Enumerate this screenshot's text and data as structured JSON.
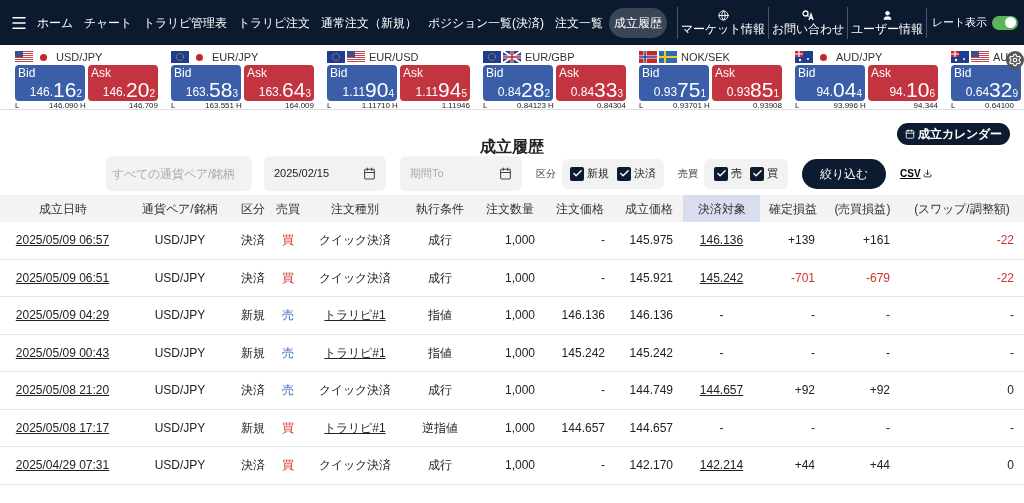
{
  "nav": {
    "items": [
      {
        "label": "ホーム",
        "selected": false
      },
      {
        "label": "チャート",
        "selected": false
      },
      {
        "label": "トラリピ管理表",
        "selected": false
      },
      {
        "label": "トラリピ注文",
        "selected": false
      },
      {
        "label": "通常注文（新規）",
        "selected": false
      },
      {
        "label": "ポジション一覧(決済)",
        "selected": false
      },
      {
        "label": "注文一覧",
        "selected": false
      },
      {
        "label": "成立履歴",
        "selected": true
      }
    ],
    "tools": [
      {
        "kind": "globe",
        "label": "マーケット情報"
      },
      {
        "kind": "qa",
        "label": "お問い合わせ"
      },
      {
        "kind": "user",
        "label": "ユーザー情報"
      }
    ],
    "rate_toggle": {
      "label": "レート表示",
      "on": true
    }
  },
  "rates": [
    {
      "pair": "USD/JPY",
      "flags": [
        {
          "kind": "us"
        },
        {
          "kind": "jp"
        }
      ],
      "bid": {
        "label": "Bid",
        "prefix": "146.",
        "big": "16",
        "pip": "2"
      },
      "ask": {
        "label": "Ask",
        "prefix": "146.",
        "big": "20",
        "pip": "2"
      },
      "low_label": "L",
      "low": "146.090",
      "high_label": "H",
      "high": "146.709"
    },
    {
      "pair": "EUR/JPY",
      "flags": [
        {
          "kind": "eu"
        },
        {
          "kind": "jp"
        }
      ],
      "bid": {
        "label": "Bid",
        "prefix": "163.",
        "big": "58",
        "pip": "3"
      },
      "ask": {
        "label": "Ask",
        "prefix": "163.",
        "big": "64",
        "pip": "3"
      },
      "low_label": "L",
      "low": "163.551",
      "high_label": "H",
      "high": "164.009"
    },
    {
      "pair": "EUR/USD",
      "flags": [
        {
          "kind": "eu"
        },
        {
          "kind": "us"
        }
      ],
      "bid": {
        "label": "Bid",
        "prefix": "1.11",
        "big": "90",
        "pip": "4"
      },
      "ask": {
        "label": "Ask",
        "prefix": "1.11",
        "big": "94",
        "pip": "5"
      },
      "low_label": "L",
      "low": "1.11710",
      "high_label": "H",
      "high": "1.11946"
    },
    {
      "pair": "EUR/GBP",
      "flags": [
        {
          "kind": "eu"
        },
        {
          "kind": "gb"
        }
      ],
      "bid": {
        "label": "Bid",
        "prefix": "0.84",
        "big": "28",
        "pip": "2"
      },
      "ask": {
        "label": "Ask",
        "prefix": "0.84",
        "big": "33",
        "pip": "3"
      },
      "low_label": "L",
      "low": "0.84123",
      "high_label": "H",
      "high": "0.84304"
    },
    {
      "pair": "NOK/SEK",
      "flags": [
        {
          "kind": "no"
        },
        {
          "kind": "se"
        }
      ],
      "bid": {
        "label": "Bid",
        "prefix": "0.93",
        "big": "75",
        "pip": "1"
      },
      "ask": {
        "label": "Ask",
        "prefix": "0.93",
        "big": "85",
        "pip": "1"
      },
      "low_label": "L",
      "low": "0.93701",
      "high_label": "H",
      "high": "0.93908"
    },
    {
      "pair": "AUD/JPY",
      "flags": [
        {
          "kind": "au"
        },
        {
          "kind": "jp"
        }
      ],
      "bid": {
        "label": "Bid",
        "prefix": "94.",
        "big": "04",
        "pip": "4"
      },
      "ask": {
        "label": "Ask",
        "prefix": "94.",
        "big": "10",
        "pip": "6"
      },
      "low_label": "L",
      "low": "93.996",
      "high_label": "H",
      "high": "94.344"
    },
    {
      "pair": "AU",
      "flags": [
        {
          "kind": "au"
        },
        {
          "kind": "us"
        }
      ],
      "bid": {
        "label": "Bid",
        "prefix": "0.64",
        "big": "32",
        "pip": "9"
      },
      "low_label": "L",
      "low": "0.64100"
    }
  ],
  "page": {
    "title": "成立履歴",
    "calendar_button": "成立カレンダー"
  },
  "filters": {
    "pair": {
      "placeholder": "すべての通貨ペア/銘柄"
    },
    "from": {
      "value": "2025/02/15"
    },
    "to": {
      "placeholder": "期間To"
    },
    "category": {
      "label": "区分",
      "options": [
        {
          "label": "新規",
          "checked": true
        },
        {
          "label": "決済",
          "checked": true
        }
      ]
    },
    "side": {
      "label": "売買",
      "options": [
        {
          "label": "売",
          "checked": true
        },
        {
          "label": "買",
          "checked": true
        }
      ]
    },
    "submit": "絞り込む",
    "csv": "CSV"
  },
  "table": {
    "columns": [
      {
        "label": "成立日時",
        "highlight": false
      },
      {
        "label": "通貨ペア/銘柄",
        "highlight": false
      },
      {
        "label": "区分",
        "highlight": false
      },
      {
        "label": "売買",
        "highlight": false
      },
      {
        "label": "注文種別",
        "highlight": false
      },
      {
        "label": "執行条件",
        "highlight": false
      },
      {
        "label": "注文数量",
        "highlight": false
      },
      {
        "label": "注文価格",
        "highlight": false
      },
      {
        "label": "成立価格",
        "highlight": false
      },
      {
        "label": "決済対象",
        "highlight": true
      },
      {
        "label": "確定損益",
        "highlight": false
      },
      {
        "label": "(売買損益)",
        "highlight": false
      },
      {
        "label": "(スワップ/調整額)",
        "highlight": false
      }
    ],
    "rows": [
      {
        "time": "2025/05/09 06:57",
        "pair": "USD/JPY",
        "category": "決済",
        "side": {
          "text": "買",
          "kind": "buy"
        },
        "order_type": {
          "text": "クイック決済",
          "link": false
        },
        "exec": "成行",
        "qty": "1,000",
        "order_price": "-",
        "fill_price": "145.975",
        "target": {
          "text": "146.136",
          "link": true
        },
        "realized": {
          "text": "+139",
          "loss": false
        },
        "trade_pnl": {
          "text": "+161",
          "loss": false
        },
        "swap": {
          "text": "-22",
          "loss": true
        }
      },
      {
        "time": "2025/05/09 06:51",
        "pair": "USD/JPY",
        "category": "決済",
        "side": {
          "text": "買",
          "kind": "buy"
        },
        "order_type": {
          "text": "クイック決済",
          "link": false
        },
        "exec": "成行",
        "qty": "1,000",
        "order_price": "-",
        "fill_price": "145.921",
        "target": {
          "text": "145.242",
          "link": true
        },
        "realized": {
          "text": "-701",
          "loss": true
        },
        "trade_pnl": {
          "text": "-679",
          "loss": true
        },
        "swap": {
          "text": "-22",
          "loss": true
        }
      },
      {
        "time": "2025/05/09 04:29",
        "pair": "USD/JPY",
        "category": "新規",
        "side": {
          "text": "売",
          "kind": "sell"
        },
        "order_type": {
          "text": "トラリピ#1",
          "link": true
        },
        "exec": "指値",
        "qty": "1,000",
        "order_price": "146.136",
        "fill_price": "146.136",
        "target": {
          "text": "-",
          "link": false
        },
        "realized": {
          "text": "-",
          "loss": false
        },
        "trade_pnl": {
          "text": "-",
          "loss": false
        },
        "swap": {
          "text": "-",
          "loss": false
        }
      },
      {
        "time": "2025/05/09 00:43",
        "pair": "USD/JPY",
        "category": "新規",
        "side": {
          "text": "売",
          "kind": "sell"
        },
        "order_type": {
          "text": "トラリピ#1",
          "link": true
        },
        "exec": "指値",
        "qty": "1,000",
        "order_price": "145.242",
        "fill_price": "145.242",
        "target": {
          "text": "-",
          "link": false
        },
        "realized": {
          "text": "-",
          "loss": false
        },
        "trade_pnl": {
          "text": "-",
          "loss": false
        },
        "swap": {
          "text": "-",
          "loss": false
        }
      },
      {
        "time": "2025/05/08 21:20",
        "pair": "USD/JPY",
        "category": "決済",
        "side": {
          "text": "売",
          "kind": "sell"
        },
        "order_type": {
          "text": "クイック決済",
          "link": false
        },
        "exec": "成行",
        "qty": "1,000",
        "order_price": "-",
        "fill_price": "144.749",
        "target": {
          "text": "144.657",
          "link": true
        },
        "realized": {
          "text": "+92",
          "loss": false
        },
        "trade_pnl": {
          "text": "+92",
          "loss": false
        },
        "swap": {
          "text": "0",
          "loss": false
        }
      },
      {
        "time": "2025/05/08 17:17",
        "pair": "USD/JPY",
        "category": "新規",
        "side": {
          "text": "買",
          "kind": "buy"
        },
        "order_type": {
          "text": "トラリピ#1",
          "link": true
        },
        "exec": "逆指値",
        "qty": "1,000",
        "order_price": "144.657",
        "fill_price": "144.657",
        "target": {
          "text": "-",
          "link": false
        },
        "realized": {
          "text": "-",
          "loss": false
        },
        "trade_pnl": {
          "text": "-",
          "loss": false
        },
        "swap": {
          "text": "-",
          "loss": false
        }
      },
      {
        "time": "2025/04/29 07:31",
        "pair": "USD/JPY",
        "category": "決済",
        "side": {
          "text": "買",
          "kind": "buy"
        },
        "order_type": {
          "text": "クイック決済",
          "link": false
        },
        "exec": "成行",
        "qty": "1,000",
        "order_price": "-",
        "fill_price": "142.170",
        "target": {
          "text": "142.214",
          "link": true
        },
        "realized": {
          "text": "+44",
          "loss": false
        },
        "trade_pnl": {
          "text": "+44",
          "loss": false
        },
        "swap": {
          "text": "0",
          "loss": false
        }
      }
    ]
  }
}
